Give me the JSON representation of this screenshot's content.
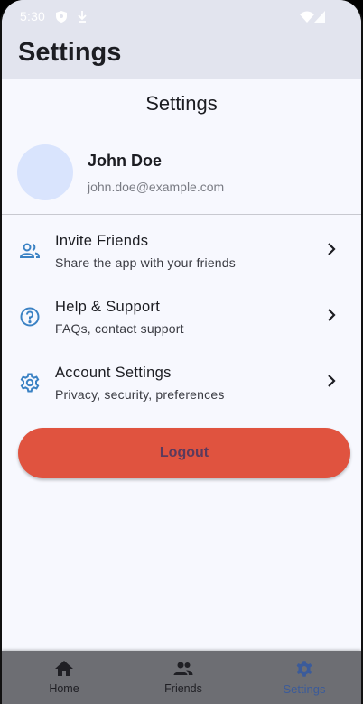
{
  "status_bar": {
    "time": "5:30",
    "icons": [
      "shield-icon",
      "download-icon",
      "wifi-icon",
      "signal-icon"
    ]
  },
  "app_bar": {
    "title": "Settings"
  },
  "page": {
    "heading": "Settings"
  },
  "profile": {
    "name": "John Doe",
    "email": "john.doe@example.com",
    "avatar_color": "#d9e4fd"
  },
  "menu": {
    "items": [
      {
        "icon": "people-outline-icon",
        "title": "Invite Friends",
        "subtitle": "Share the app with your friends"
      },
      {
        "icon": "help-circle-icon",
        "title": "Help & Support",
        "subtitle": "FAQs, contact support"
      },
      {
        "icon": "gear-outline-icon",
        "title": "Account Settings",
        "subtitle": "Privacy, security, preferences"
      }
    ]
  },
  "logout": {
    "label": "Logout",
    "color": "#e0533f"
  },
  "bottom_nav": {
    "items": [
      {
        "icon": "home-icon",
        "label": "Home",
        "active": false
      },
      {
        "icon": "people-icon",
        "label": "Friends",
        "active": false
      },
      {
        "icon": "gear-icon",
        "label": "Settings",
        "active": true
      }
    ]
  },
  "colors": {
    "accent": "#3b82c4",
    "background": "#f7f8fe",
    "app_bar": "#e2e4ee",
    "nav_active": "#3b5b9a"
  }
}
